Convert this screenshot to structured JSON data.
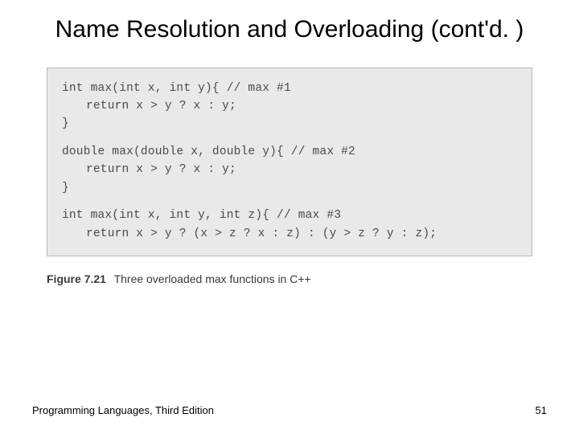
{
  "title": "Name Resolution and Overloading (cont'd. )",
  "code": {
    "fn1_sig": "int max(int x, int y){ // max #1",
    "fn1_body": "return x > y ? x : y;",
    "fn1_close": "}",
    "fn2_sig": "double max(double x, double y){ // max #2",
    "fn2_body": "return x > y ? x : y;",
    "fn2_close": "}",
    "fn3_sig": "int max(int x, int y, int z){ // max #3",
    "fn3_body": "return x > y ? (x > z ? x : z) : (y > z ? y : z);"
  },
  "caption": {
    "label": "Figure 7.21",
    "text": "Three overloaded max functions in C++"
  },
  "footer": {
    "left": "Programming Languages, Third Edition",
    "right": "51"
  }
}
